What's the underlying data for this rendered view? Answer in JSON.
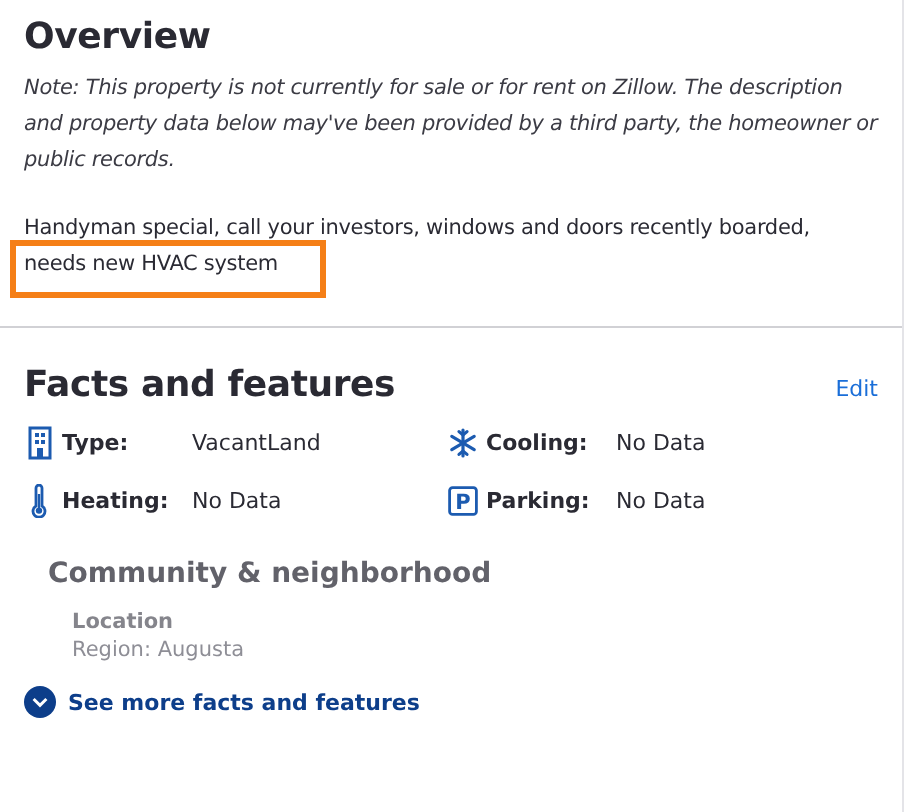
{
  "overview": {
    "title": "Overview",
    "note": "Note: This property is not currently for sale or for rent on Zillow. The description and property data below may've been provided by a third party, the homeowner or public records.",
    "description": {
      "text": "Handyman special, call your investors, windows and doors recently boarded, needs new HVAC system",
      "highlighted": true
    }
  },
  "facts": {
    "title": "Facts and features",
    "edit": "Edit",
    "items": [
      {
        "kind": "building",
        "label": "Type:",
        "value": "VacantLand"
      },
      {
        "kind": "snowflake",
        "label": "Cooling:",
        "value": "No Data"
      },
      {
        "kind": "thermometer",
        "label": "Heating:",
        "value": "No Data"
      },
      {
        "kind": "parking",
        "icon_text": "P",
        "label": "Parking:",
        "value": "No Data"
      }
    ],
    "community": {
      "title": "Community & neighborhood",
      "subtitle": "Location",
      "detail": "Region: Augusta"
    },
    "see_more": "See more facts and features"
  }
}
